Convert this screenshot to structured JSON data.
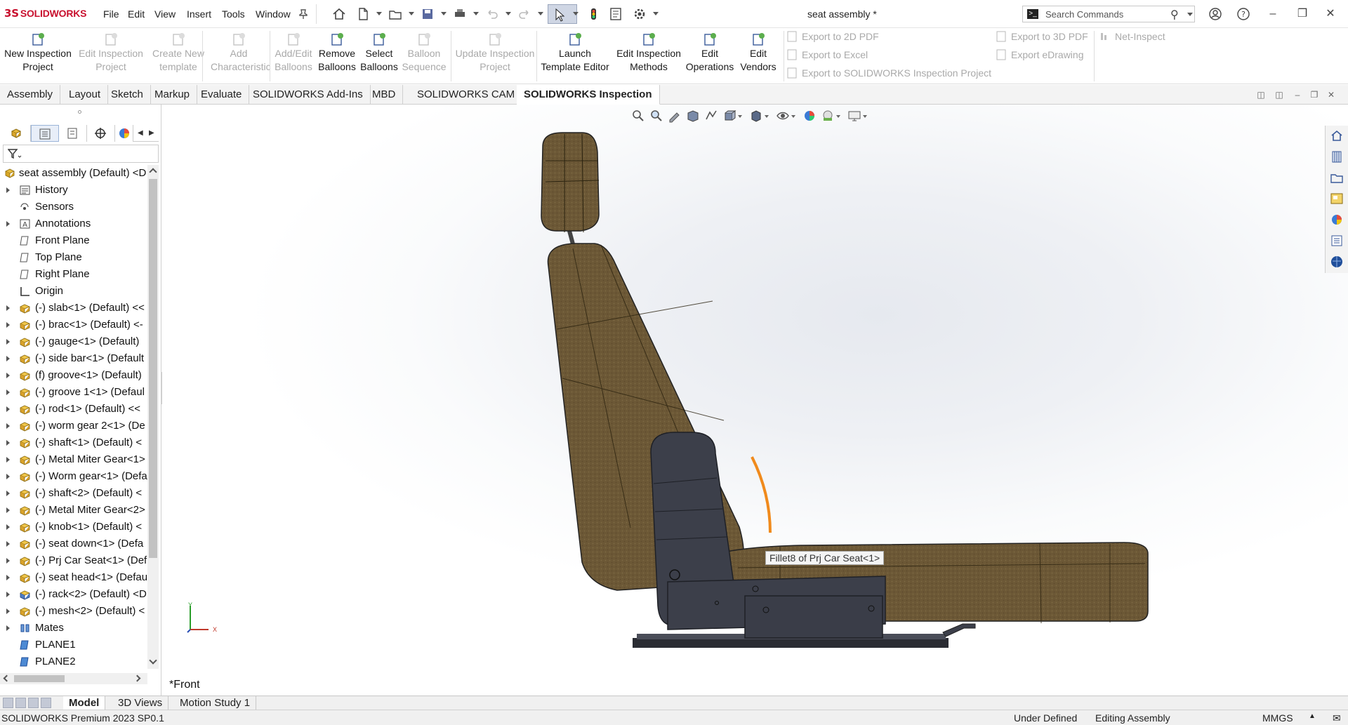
{
  "app": {
    "brand": "SOLIDWORKS",
    "document_title": "seat assembly *",
    "menu": [
      "File",
      "Edit",
      "View",
      "Insert",
      "Tools",
      "Window"
    ],
    "search_placeholder": "Search Commands"
  },
  "ribbon": {
    "buttons": [
      {
        "line1": "New Inspection",
        "line2": "Project",
        "enabled": true
      },
      {
        "line1": "Edit Inspection",
        "line2": "Project",
        "enabled": false
      },
      {
        "line1": "Create New",
        "line2": "template",
        "enabled": false
      },
      {
        "line1": "Add",
        "line2": "Characteristic",
        "enabled": false
      },
      {
        "line1": "Add/Edit",
        "line2": "Balloons",
        "enabled": false
      },
      {
        "line1": "Remove",
        "line2": "Balloons",
        "enabled": true
      },
      {
        "line1": "Select",
        "line2": "Balloons",
        "enabled": true
      },
      {
        "line1": "Balloon",
        "line2": "Sequence",
        "enabled": false
      },
      {
        "line1": "Update Inspection",
        "line2": "Project",
        "enabled": false
      },
      {
        "line1": "Launch",
        "line2": "Template Editor",
        "enabled": true
      },
      {
        "line1": "Edit Inspection",
        "line2": "Methods",
        "enabled": true
      },
      {
        "line1": "Edit",
        "line2": "Operations",
        "enabled": true
      },
      {
        "line1": "Edit",
        "line2": "Vendors",
        "enabled": true
      }
    ],
    "export": {
      "pdf2d": "Export to 2D PDF",
      "excel": "Export to Excel",
      "sw_project": "Export to SOLIDWORKS Inspection Project",
      "pdf3d": "Export to 3D PDF",
      "edrawing": "Export eDrawing",
      "net_inspect": "Net-Inspect"
    }
  },
  "tabs": [
    "Assembly",
    "Layout",
    "Sketch",
    "Markup",
    "Evaluate",
    "SOLIDWORKS Add-Ins",
    "MBD",
    "SOLIDWORKS CAM",
    "SOLIDWORKS Inspection"
  ],
  "active_tab": "SOLIDWORKS Inspection",
  "tree": {
    "root": "seat assembly (Default) <D",
    "items": [
      {
        "label": "History",
        "icon": "history-folder-icon",
        "expand": true
      },
      {
        "label": "Sensors",
        "icon": "sensor-icon",
        "expand": false
      },
      {
        "label": "Annotations",
        "icon": "annotation-icon",
        "expand": true
      },
      {
        "label": "Front Plane",
        "icon": "plane-icon",
        "expand": false
      },
      {
        "label": "Top Plane",
        "icon": "plane-icon",
        "expand": false
      },
      {
        "label": "Right Plane",
        "icon": "plane-icon",
        "expand": false
      },
      {
        "label": "Origin",
        "icon": "origin-icon",
        "expand": false
      },
      {
        "label": "(-) slab<1> (Default) <<",
        "icon": "part-icon",
        "expand": true
      },
      {
        "label": "(-) brac<1> (Default) <-",
        "icon": "part-icon",
        "expand": true
      },
      {
        "label": "(-) gauge<1> (Default)",
        "icon": "part-icon",
        "expand": true
      },
      {
        "label": "(-) side bar<1> (Default",
        "icon": "part-icon",
        "expand": true
      },
      {
        "label": "(f) groove<1> (Default)",
        "icon": "part-icon",
        "expand": true
      },
      {
        "label": "(-) groove 1<1> (Defaul",
        "icon": "part-icon",
        "expand": true
      },
      {
        "label": "(-) rod<1> (Default) <<",
        "icon": "part-icon",
        "expand": true
      },
      {
        "label": "(-) worm gear 2<1> (De",
        "icon": "part-icon",
        "expand": true
      },
      {
        "label": "(-) shaft<1> (Default) <",
        "icon": "part-icon",
        "expand": true
      },
      {
        "label": "(-) Metal Miter Gear<1>",
        "icon": "part-icon",
        "expand": true
      },
      {
        "label": "(-) Worm gear<1> (Defa",
        "icon": "part-icon",
        "expand": true
      },
      {
        "label": "(-) shaft<2> (Default) <",
        "icon": "part-icon",
        "expand": true
      },
      {
        "label": "(-) Metal Miter Gear<2>",
        "icon": "part-icon",
        "expand": true
      },
      {
        "label": "(-) knob<1> (Default) <",
        "icon": "part-icon",
        "expand": true
      },
      {
        "label": "(-) seat down<1> (Defa",
        "icon": "part-icon",
        "expand": true
      },
      {
        "label": "(-) Prj Car Seat<1> (Def",
        "icon": "part-icon",
        "expand": true
      },
      {
        "label": "(-) seat head<1> (Defau",
        "icon": "part-icon",
        "expand": true
      },
      {
        "label": "(-) rack<2> (Default) <D",
        "icon": "subassembly-icon",
        "expand": true
      },
      {
        "label": "(-) mesh<2> (Default) <",
        "icon": "part-icon",
        "expand": true
      },
      {
        "label": "Mates",
        "icon": "mates-icon",
        "expand": true
      },
      {
        "label": "PLANE1",
        "icon": "plane-blue-icon",
        "expand": false
      },
      {
        "label": "PLANE2",
        "icon": "plane-blue-icon",
        "expand": false
      }
    ]
  },
  "viewport": {
    "tooltip": "Fillet8 of Prj Car Seat<1>",
    "view_name": "*Front",
    "triad_y": "Y",
    "triad_x": "X"
  },
  "bottom_tabs": [
    "Model",
    "3D Views",
    "Motion Study 1"
  ],
  "active_bottom_tab": "Model",
  "status": {
    "product": "SOLIDWORKS Premium 2023 SP0.1",
    "definition": "Under Defined",
    "mode": "Editing Assembly",
    "units": "MMGS"
  },
  "colors": {
    "brand_red": "#c8102e",
    "fabric": "#6e5a3a",
    "steel": "#3c3f4a",
    "highlight": "#f08a1c"
  }
}
